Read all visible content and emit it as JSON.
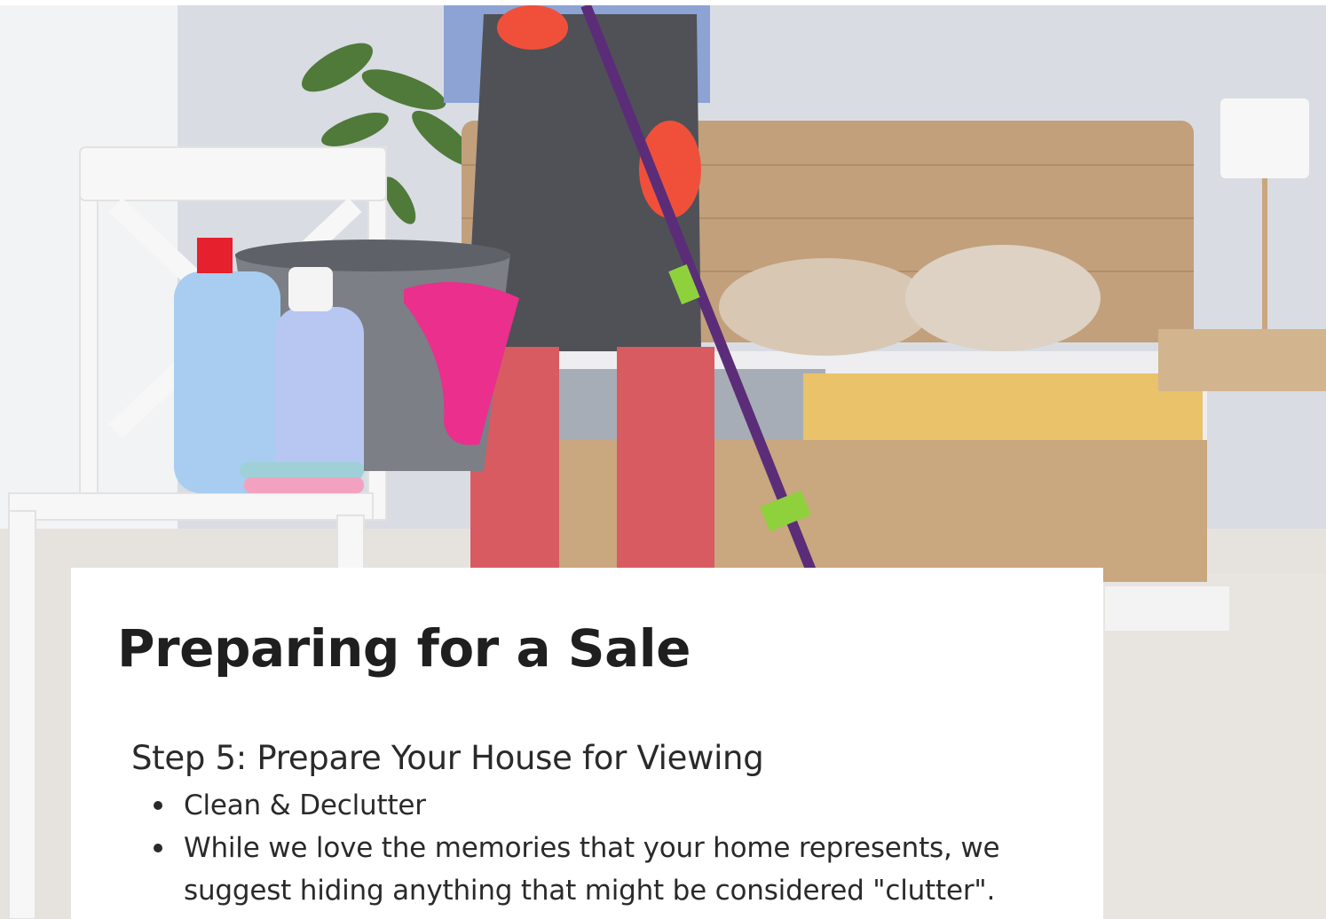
{
  "hero": {
    "image": "cleaning-bedroom-photo",
    "colors": {
      "wall": "#d9dce3",
      "floor": "#e6e3df",
      "headboard": "#c2a07c",
      "apron": "#4f5157",
      "gloves": "#f0503a",
      "pants": "#d85b62",
      "bottle": "#a8cdf0",
      "cloth": "#ea2f8c",
      "mop_handle": "#5b2d78",
      "mop_accent": "#8fd13c"
    }
  },
  "card": {
    "title": "Preparing for a Sale",
    "step": "Step 5: Prepare Your House for Viewing",
    "bullets": [
      "Clean & Declutter",
      "While we love the memories that your home represents, we suggest hiding anything that might be considered \"clutter\"."
    ]
  }
}
